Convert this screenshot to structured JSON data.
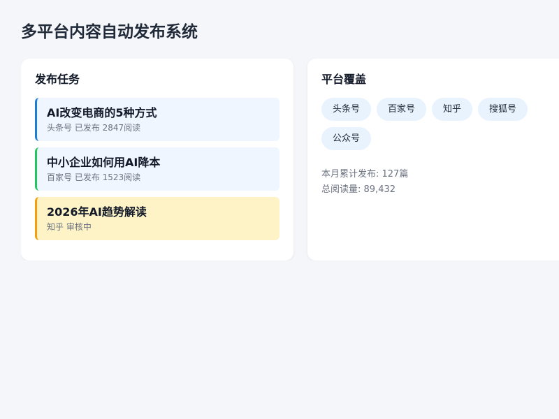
{
  "page": {
    "title": "多平台内容自动发布系统"
  },
  "tasks_card": {
    "title": "发布任务",
    "items": [
      {
        "title": "AI改变电商的5种方式",
        "meta": "头条号 已发布 2847阅读",
        "status_color": "#1e7bd6"
      },
      {
        "title": "中小企业如何用AI降本",
        "meta": "百家号 已发布 1523阅读",
        "status_color": "#22c55e"
      },
      {
        "title": "2026年AI趋势解读",
        "meta": "知乎 审核中",
        "status_color": "#f59e0b"
      }
    ]
  },
  "platforms_card": {
    "title": "平台覆盖",
    "tags": [
      "头条号",
      "百家号",
      "知乎",
      "搜狐号",
      "公众号"
    ],
    "stats": {
      "monthly_label": "本月累计发布: ",
      "monthly_value": "127篇",
      "reads_label": "总阅读量: ",
      "reads_value": "89,432"
    }
  }
}
